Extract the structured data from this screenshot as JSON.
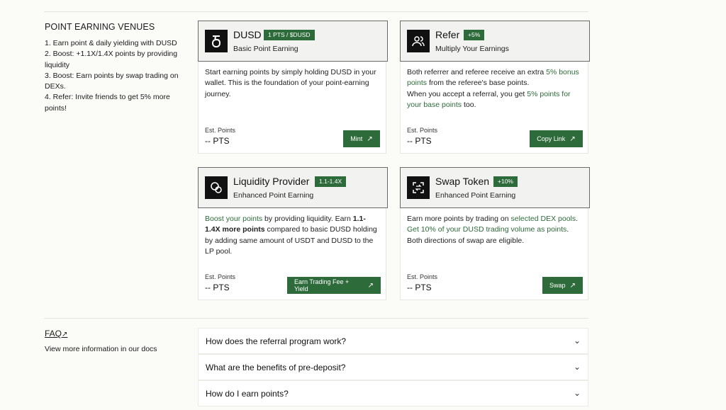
{
  "sidebar": {
    "title": "POINT EARNING VENUES",
    "items": [
      "1. Earn point & daily yielding with DUSD",
      "2. Boost: +1.1X/1.4X points by providing liquidity",
      "3. Boost: Earn points by swap trading on DEXs.",
      "4. Refer: Invite friends to get 5% more points!"
    ]
  },
  "cards": {
    "dusd": {
      "title": "DUSD",
      "badge": "1 PTS / $DUSD",
      "subtitle": "Basic Point Earning",
      "body": "Start earning points by simply holding DUSD in your wallet. This is the foundation of your point-earning journey.",
      "est_label": "Est. Points",
      "est_value": "-- PTS",
      "button": "Mint",
      "icon": "dusd-logo-icon"
    },
    "refer": {
      "title": "Refer",
      "badge": "+5%",
      "subtitle": "Multiply Your Earnings",
      "body_1": "Both referrer and referee receive an extra ",
      "body_hl1": "5% bonus points",
      "body_2": " from the referee's base points.",
      "body_3": "When you accept a referral, you get ",
      "body_hl2": "5% points for your base points",
      "body_4": " too.",
      "est_label": "Est. Points",
      "est_value": "-- PTS",
      "button": "Copy Link",
      "icon": "users-icon"
    },
    "lp": {
      "title": "Liquidity Provider",
      "badge": "1.1-1.4X",
      "subtitle": "Enhanced Point Earning",
      "body_hl": "Boost your points",
      "body_1": " by providing liquidity. Earn ",
      "body_bold": "1.1-1.4X more points",
      "body_2": " compared to basic DUSD holding by adding same amount of USDT and DUSD to the LP pool.",
      "est_label": "Est. Points",
      "est_value": "-- PTS",
      "button": "Earn Trading Fee + Yield",
      "icon": "coins-icon"
    },
    "swap": {
      "title": "Swap Token",
      "badge": "+10%",
      "subtitle": "Enhanced Point Earning",
      "body_1": "Earn more points by trading on ",
      "body_hl1": "selected DEX pools",
      "body_2": ".",
      "body_hl2": "Get 10% of your DUSD trading volume as points",
      "body_3": ".",
      "body_4": "Both directions of swap are eligible.",
      "est_label": "Est. Points",
      "est_value": "-- PTS",
      "button": "Swap",
      "icon": "swap-icon"
    }
  },
  "faq": {
    "link": "FAQ",
    "subtitle": "View more information in our docs",
    "questions": [
      "How does the referral program work?",
      "What are the benefits of pre-deposit?",
      "How do I earn points?"
    ]
  },
  "colors": {
    "accent": "#2e6b3a",
    "icon_bg": "#111111"
  }
}
